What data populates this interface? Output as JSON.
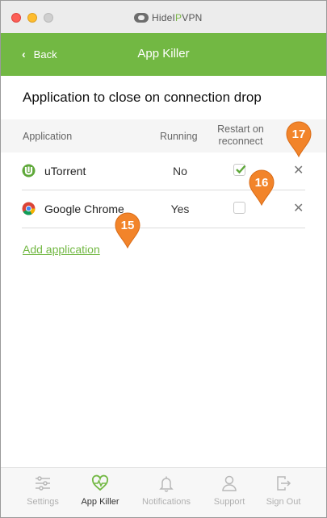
{
  "brand": {
    "name_left": "HideI",
    "name_mid": "P",
    "name_right": "VPN"
  },
  "nav": {
    "back_label": "Back",
    "title": "App Killer"
  },
  "section_title": "Application to close on connection drop",
  "table": {
    "headers": {
      "application": "Application",
      "running": "Running",
      "restart_line1": "Restart on",
      "restart_line2": "reconnect"
    },
    "rows": [
      {
        "name": "uTorrent",
        "running": "No",
        "restart_checked": true,
        "icon": "utorrent-icon"
      },
      {
        "name": "Google Chrome",
        "running": "Yes",
        "restart_checked": false,
        "icon": "chrome-icon"
      }
    ]
  },
  "add_link": "Add application",
  "callouts": [
    "15",
    "16",
    "17"
  ],
  "tabs": [
    {
      "label": "Settings",
      "icon": "sliders-icon",
      "active": false
    },
    {
      "label": "App Killer",
      "icon": "heart-pulse-icon",
      "active": true
    },
    {
      "label": "Notifications",
      "icon": "bell-icon",
      "active": false
    },
    {
      "label": "Support",
      "icon": "person-icon",
      "active": false
    },
    {
      "label": "Sign Out",
      "icon": "sign-out-icon",
      "active": false
    }
  ],
  "colors": {
    "accent": "#72b843",
    "callout": "#f2842a"
  }
}
